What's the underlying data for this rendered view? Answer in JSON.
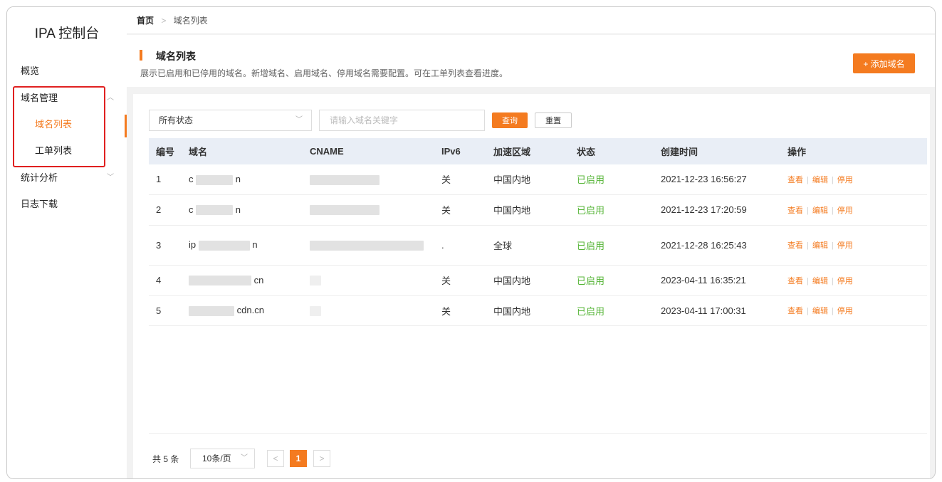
{
  "app": {
    "title": "IPA 控制台"
  },
  "sidebar": {
    "items": [
      {
        "label": "概览"
      },
      {
        "label": "域名管理"
      },
      {
        "label": "域名列表"
      },
      {
        "label": "工单列表"
      },
      {
        "label": "统计分析"
      },
      {
        "label": "日志下载"
      }
    ]
  },
  "breadcrumb": {
    "home": "首页",
    "current": "域名列表"
  },
  "page": {
    "title": "域名列表",
    "description": "展示已启用和已停用的域名。新增域名、启用域名、停用域名需要配置。可在工单列表查看进度。",
    "add_button": "+ 添加域名"
  },
  "filter": {
    "status_value": "所有状态",
    "search_placeholder": "请输入域名关键字",
    "query_button": "查询",
    "reset_button": "重置"
  },
  "table": {
    "columns": [
      "编号",
      "域名",
      "CNAME",
      "IPv6",
      "加速区域",
      "状态",
      "创建时间",
      "操作"
    ],
    "rows": [
      {
        "num": "1",
        "domain_prefix": "c",
        "domain_suffix": "n",
        "ipv6": "关",
        "region": "中国内地",
        "status": "已启用",
        "created": "2021-12-23 16:56:27"
      },
      {
        "num": "2",
        "domain_prefix": "c",
        "domain_suffix": "n",
        "ipv6": "关",
        "region": "中国内地",
        "status": "已启用",
        "created": "2021-12-23 17:20:59"
      },
      {
        "num": "3",
        "domain_prefix": "ip",
        "domain_suffix": "n",
        "ipv6": ".",
        "region": "全球",
        "status": "已启用",
        "created": "2021-12-28 16:25:43"
      },
      {
        "num": "4",
        "domain_prefix": "",
        "domain_suffix": "cn",
        "ipv6": "关",
        "region": "中国内地",
        "status": "已启用",
        "created": "2023-04-11 16:35:21"
      },
      {
        "num": "5",
        "domain_prefix": "",
        "domain_suffix": "cdn.cn",
        "ipv6": "关",
        "region": "中国内地",
        "status": "已启用",
        "created": "2023-04-11 17:00:31"
      }
    ],
    "actions": {
      "view": "查看",
      "edit": "编辑",
      "disable": "停用"
    }
  },
  "pagination": {
    "total": "共 5 条",
    "page_size": "10条/页",
    "prev": "<",
    "current": "1",
    "next": ">"
  },
  "colors": {
    "accent": "#f47b20",
    "enabled": "#54b435",
    "highlight_box": "#e02020"
  },
  "icons": {
    "dropdown": "chevron-down-icon",
    "collapse": "chevron-up-icon"
  }
}
